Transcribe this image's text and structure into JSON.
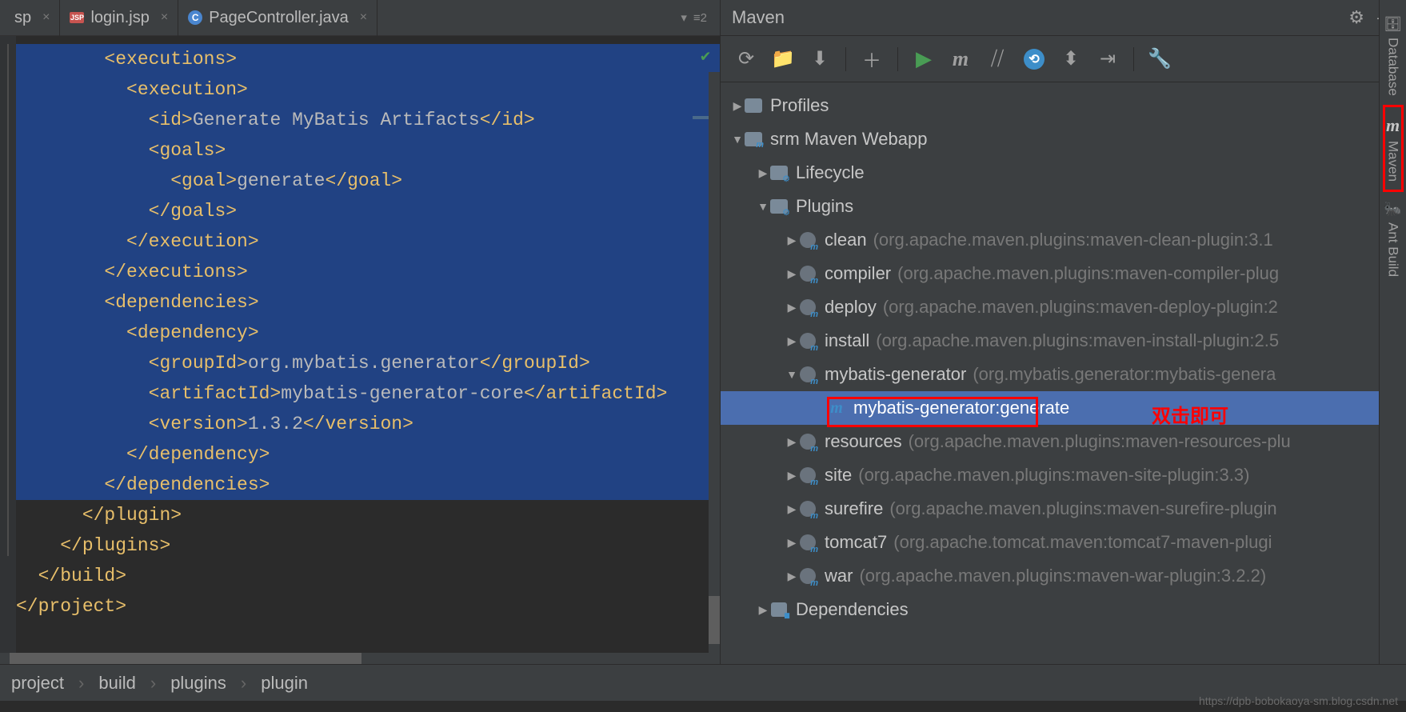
{
  "tabs": {
    "t0": {
      "label": "sp"
    },
    "t1": {
      "label": "login.jsp",
      "ico": "JSP"
    },
    "t2": {
      "label": "PageController.java",
      "ico": "C"
    }
  },
  "tabRight": "≡2",
  "code": {
    "l1a": "<executions>",
    "l2a": "<execution>",
    "l3a": "<id>",
    "l3b": "Generate MyBatis Artifacts",
    "l3c": "</id>",
    "l4a": "<goals>",
    "l5a": "<goal>",
    "l5b": "generate",
    "l5c": "</goal>",
    "l6a": "</goals>",
    "l7a": "</execution>",
    "l8a": "</executions>",
    "l9a": "<dependencies>",
    "l10a": "<dependency>",
    "l11a": "<groupId>",
    "l11b": "org.mybatis.generator",
    "l11c": "</groupId>",
    "l12a": "<artifactId>",
    "l12b": "mybatis-generator-core",
    "l12c": "</artifactId>",
    "l13a": "<version>",
    "l13b": "1.3.2",
    "l13c": "</version>",
    "l14a": "</dependency>",
    "l15a": "</dependencies>",
    "l16a": "</plugin>",
    "l17a": "</plugins>",
    "l18a": "</build>",
    "l19a": "</project>"
  },
  "maven": {
    "title": "Maven",
    "tree": {
      "profiles": "Profiles",
      "root": "srm Maven Webapp",
      "lifecycle": "Lifecycle",
      "plugins": "Plugins",
      "dependencies": "Dependencies",
      "items": [
        {
          "n": "clean",
          "d": "(org.apache.maven.plugins:maven-clean-plugin:3.1"
        },
        {
          "n": "compiler",
          "d": "(org.apache.maven.plugins:maven-compiler-plug"
        },
        {
          "n": "deploy",
          "d": "(org.apache.maven.plugins:maven-deploy-plugin:2"
        },
        {
          "n": "install",
          "d": "(org.apache.maven.plugins:maven-install-plugin:2.5"
        },
        {
          "n": "mybatis-generator",
          "d": "(org.mybatis.generator:mybatis-genera"
        },
        {
          "n": "resources",
          "d": "(org.apache.maven.plugins:maven-resources-plu"
        },
        {
          "n": "site",
          "d": "(org.apache.maven.plugins:maven-site-plugin:3.3)"
        },
        {
          "n": "surefire",
          "d": "(org.apache.maven.plugins:maven-surefire-plugin"
        },
        {
          "n": "tomcat7",
          "d": "(org.apache.tomcat.maven:tomcat7-maven-plugi"
        },
        {
          "n": "war",
          "d": "(org.apache.maven.plugins:maven-war-plugin:3.2.2)"
        }
      ],
      "goal": "mybatis-generator:generate"
    }
  },
  "annotation": "双击即可",
  "rightBar": {
    "database": "Database",
    "maven": "Maven",
    "ant": "Ant Build"
  },
  "breadcrumb": {
    "b1": "project",
    "b2": "build",
    "b3": "plugins",
    "b4": "plugin"
  },
  "watermark": "https://dpb-bobokaoya-sm.blog.csdn.net"
}
